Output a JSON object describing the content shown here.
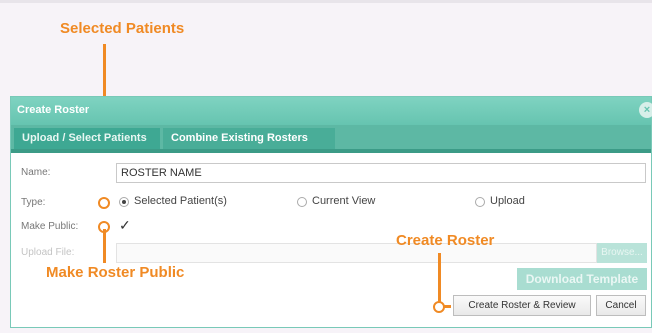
{
  "callouts": {
    "selected_patients": "Selected Patients",
    "make_public": "Make Roster Public",
    "create_roster": "Create Roster"
  },
  "dialog": {
    "title": "Create Roster",
    "tabs": [
      {
        "label": "Upload / Select Patients",
        "active": true
      },
      {
        "label": "Combine Existing Rosters",
        "active": false
      }
    ],
    "name_label": "Name:",
    "name_value": "ROSTER NAME",
    "type_label": "Type:",
    "type_options": [
      {
        "label": "Selected Patient(s)",
        "selected": true
      },
      {
        "label": "Current View",
        "selected": false
      },
      {
        "label": "Upload",
        "selected": false
      }
    ],
    "make_public_label": "Make Public:",
    "make_public_checked": true,
    "upload_file_label": "Upload File:",
    "browse_label": "Browse...",
    "download_template_label": "Download Template",
    "create_review_label": "Create Roster & Review",
    "cancel_label": "Cancel"
  },
  "colors": {
    "accent": "#66c4b0",
    "callout": "#f08a24"
  }
}
